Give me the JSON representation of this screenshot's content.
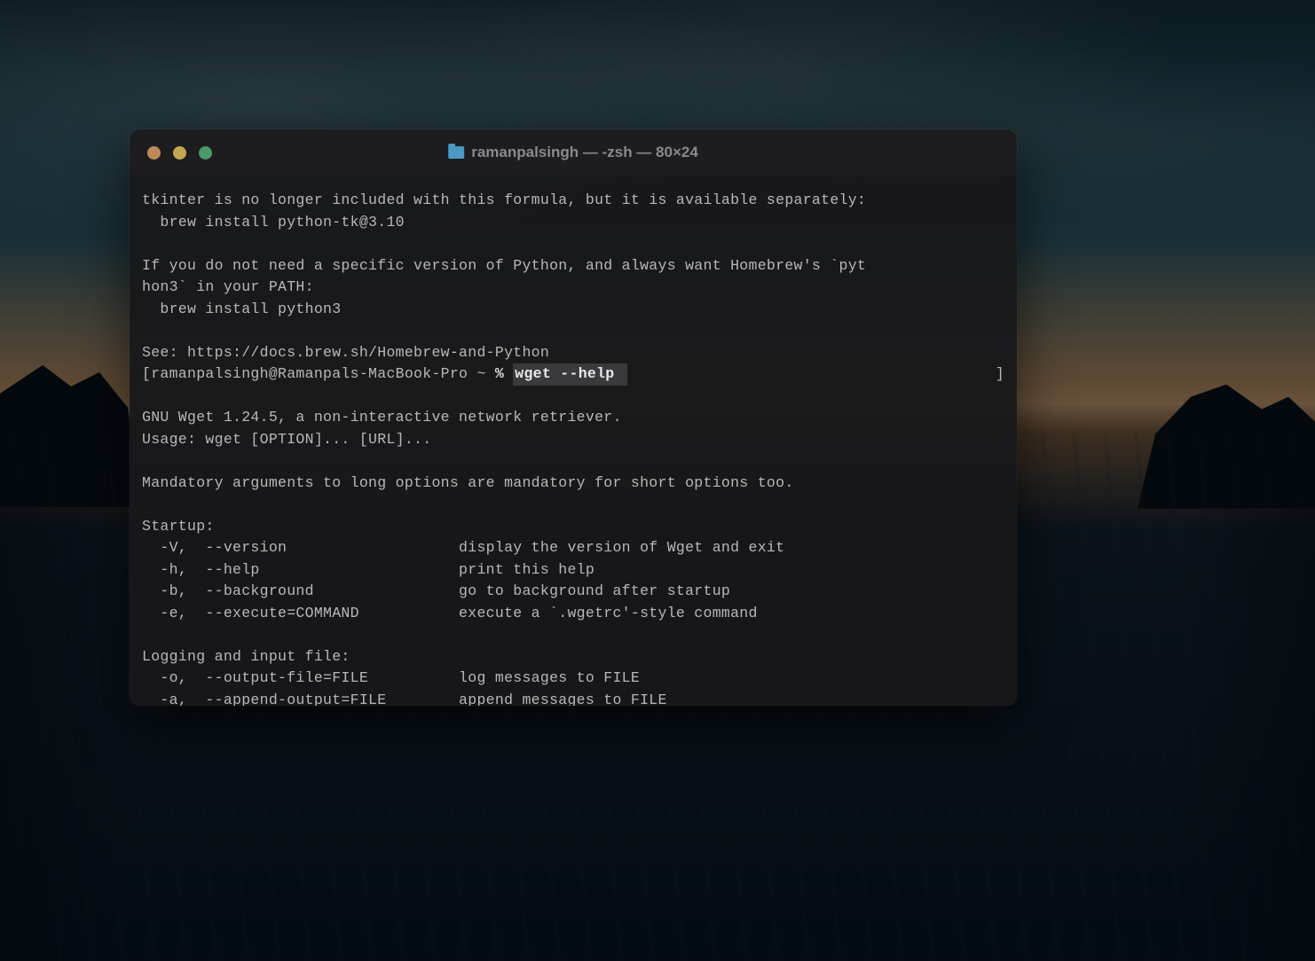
{
  "window": {
    "title": "ramanpalsingh — -zsh — 80×24",
    "folder_icon": "folder-icon"
  },
  "terminal": {
    "lines": [
      "tkinter is no longer included with this formula, but it is available separately:",
      "  brew install python-tk@3.10",
      "",
      "If you do not need a specific version of Python, and always want Homebrew's `pyt",
      "hon3` in your PATH:",
      "  brew install python3",
      "",
      "See: https://docs.brew.sh/Homebrew-and-Python"
    ],
    "prompt": {
      "open": "[",
      "user_host": "ramanpalsingh@Ramanpals-MacBook-Pro ~ ",
      "symbol": "% ",
      "command": "wget --help ",
      "close": "]"
    },
    "output": [
      "GNU Wget 1.24.5, a non-interactive network retriever.",
      "Usage: wget [OPTION]... [URL]...",
      "",
      "Mandatory arguments to long options are mandatory for short options too.",
      "",
      "Startup:",
      "  -V,  --version                   display the version of Wget and exit",
      "  -h,  --help                      print this help",
      "  -b,  --background                go to background after startup",
      "  -e,  --execute=COMMAND           execute a `.wgetrc'-style command",
      "",
      "Logging and input file:",
      "  -o,  --output-file=FILE          log messages to FILE",
      "  -a,  --append-output=FILE        append messages to FILE"
    ]
  }
}
